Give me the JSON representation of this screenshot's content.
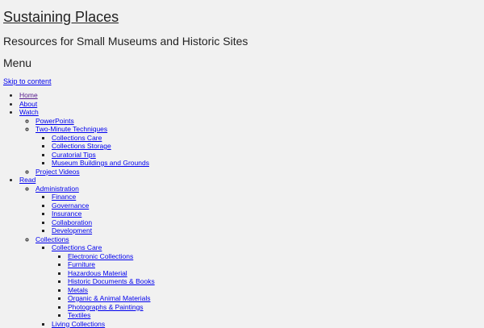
{
  "site": {
    "title": "Sustaining Places",
    "description": "Resources for Small Museums and Historic Sites",
    "menu_label": "Menu",
    "skip_link": "Skip to content"
  },
  "nav": {
    "home": "Home",
    "about": "About",
    "watch": {
      "label": "Watch",
      "powerpoints": "PowerPoints",
      "two_minute": {
        "label": "Two-Minute Techniques",
        "items": [
          "Collections Care",
          "Collections Storage",
          "Curatorial Tips",
          "Museum Buildings and Grounds"
        ]
      },
      "project_videos": "Project Videos"
    },
    "read": {
      "label": "Read",
      "administration": {
        "label": "Administration",
        "items": [
          "Finance",
          "Governance",
          "Insurance",
          "Collaboration",
          "Development"
        ]
      },
      "collections": {
        "label": "Collections",
        "collections_care": {
          "label": "Collections Care",
          "items": [
            "Electronic Collections",
            "Furniture",
            "Hazardous Material",
            "Historic Documents & Books",
            "Metals",
            "Organic & Animal Materials",
            "Photographs & Paintings",
            "Textiles"
          ]
        },
        "living_collections": "Living Collections"
      }
    }
  }
}
